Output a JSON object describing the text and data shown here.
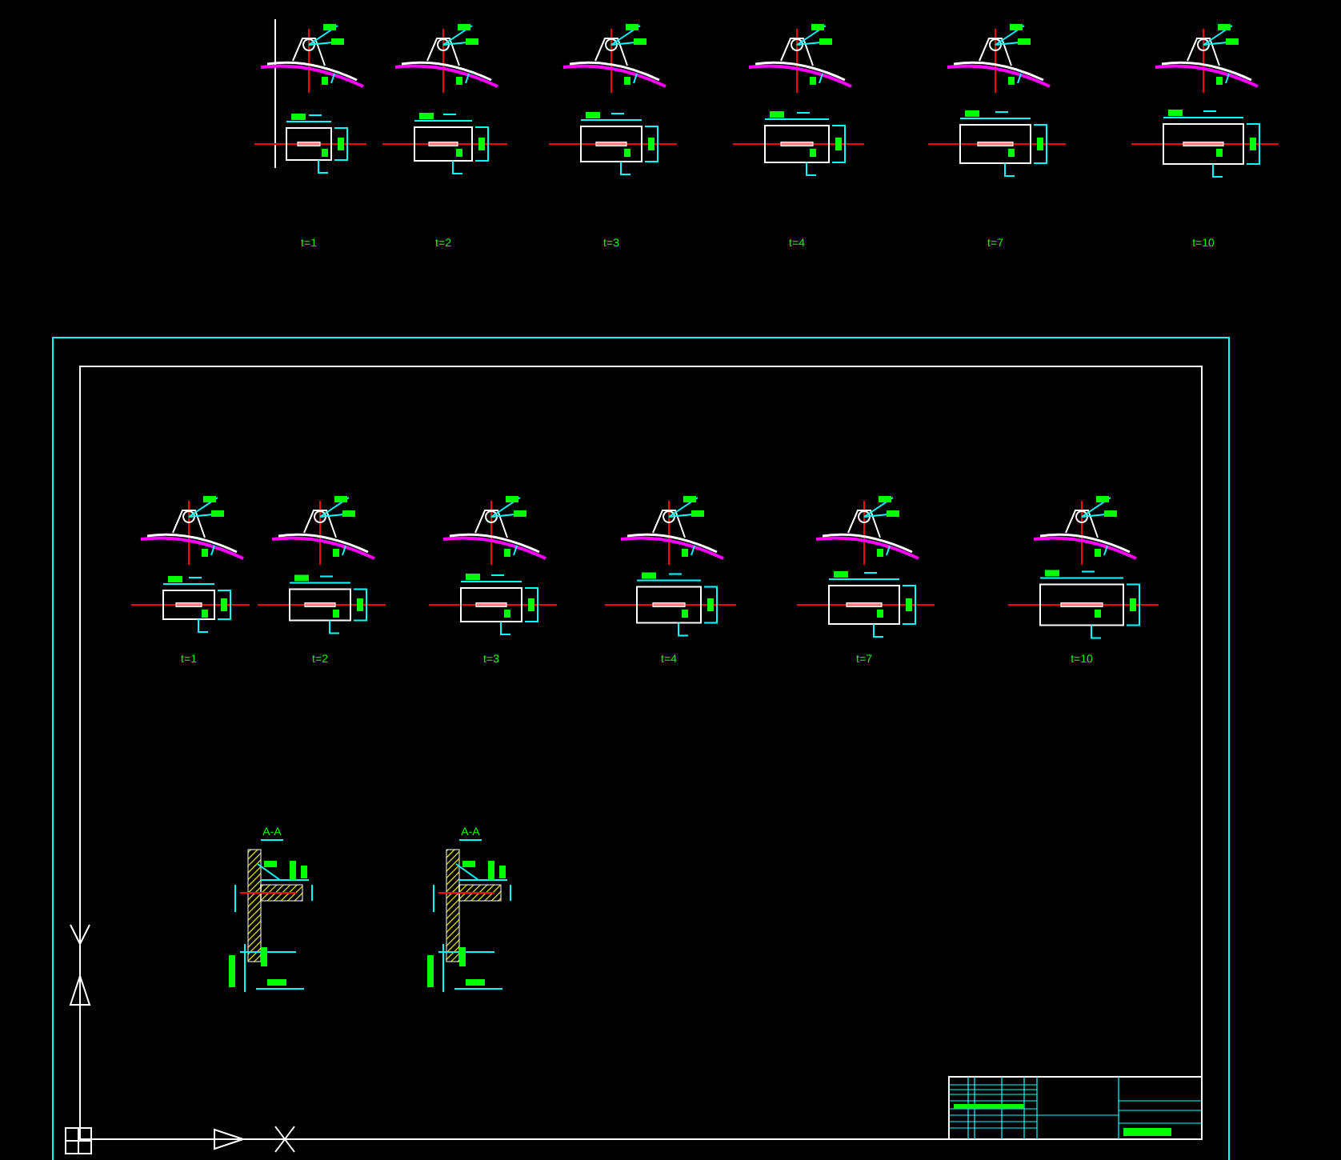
{
  "top_row": {
    "details": [
      {
        "label": "t=1"
      },
      {
        "label": "t=2"
      },
      {
        "label": "t=3"
      },
      {
        "label": "t=4"
      },
      {
        "label": "t=7"
      },
      {
        "label": "t=10"
      }
    ]
  },
  "frame": {
    "details": [
      {
        "label": "t=1"
      },
      {
        "label": "t=2"
      },
      {
        "label": "t=3"
      },
      {
        "label": "t=4"
      },
      {
        "label": "t=7"
      },
      {
        "label": "t=10"
      }
    ],
    "sections": [
      {
        "label": "A-A"
      },
      {
        "label": "A-A"
      }
    ]
  }
}
